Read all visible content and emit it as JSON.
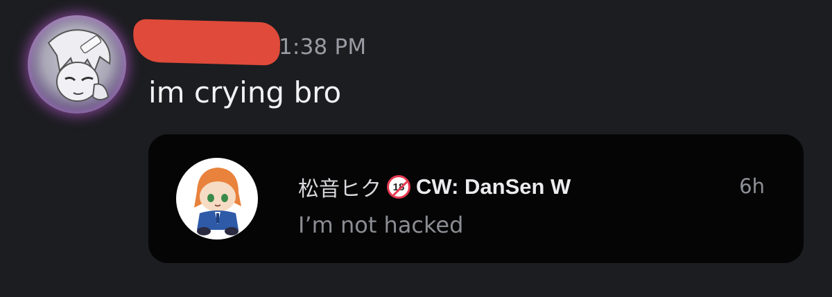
{
  "message": {
    "author_redacted": true,
    "timestamp": "1:38 PM",
    "text": "im crying bro",
    "author_avatar_icon": "user-avatar-icon"
  },
  "embed": {
    "author_name_jp": "松音ヒク",
    "badge_text": "18",
    "badge_icon": "no-under-18-icon",
    "author_suffix": "CW: DanSen W",
    "time": "6h",
    "text": "I’m not hacked",
    "avatar_icon": "plush-avatar-icon"
  },
  "colors": {
    "background": "#1c1d21",
    "card": "#050506",
    "redaction": "#e04a3a",
    "avatar_glow": "#c45cdc",
    "badge_red": "#e53950"
  }
}
